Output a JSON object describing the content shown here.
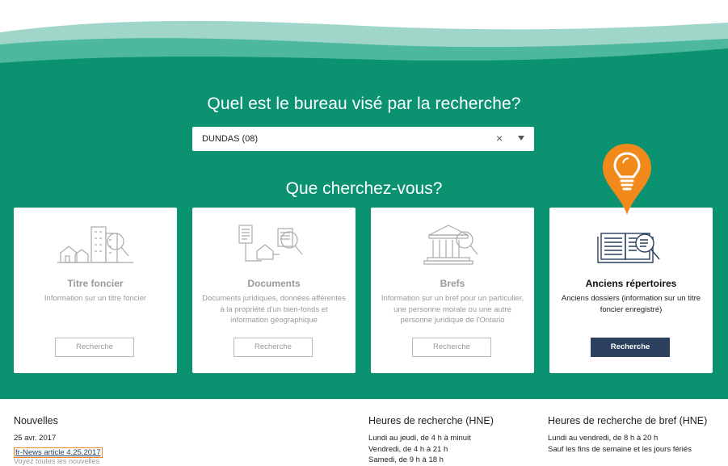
{
  "colors": {
    "hero_green": "#0b9270",
    "wave_light": "#9fd6c9",
    "wave_mid": "#4db89e",
    "primary_button": "#2b3f5f",
    "pin_orange": "#f28a1b"
  },
  "office": {
    "question": "Quel est le bureau visé par la recherche?",
    "selected_value": "DUNDAS (08)",
    "clear_glyph": "×"
  },
  "search": {
    "question": "Que cherchez-vous?",
    "cards": [
      {
        "icon": "houses-buildings-magnifier-icon",
        "title": "Titre foncier",
        "description": "Information sur un titre foncier",
        "button": "Recherche",
        "active": false
      },
      {
        "icon": "documents-house-magnifier-icon",
        "title": "Documents",
        "description": "Documents juridiques, données afférentes à la propriété d'un bien-fonds et information géographique",
        "button": "Recherche",
        "active": false
      },
      {
        "icon": "courthouse-magnifier-icon",
        "title": "Brefs",
        "description": "Information sur un bref pour un particulier, une personne morale ou une autre personne juridique de l'Ontario",
        "button": "Recherche",
        "active": false
      },
      {
        "icon": "open-book-magnifier-icon",
        "title": "Anciens répertoires",
        "description": "Anciens dossiers (information sur un titre foncier enregistré)",
        "button": "Recherche",
        "active": true
      }
    ],
    "tip_icon": "lightbulb-icon"
  },
  "footer": {
    "news": {
      "heading": "Nouvelles",
      "date": "25 avr. 2017",
      "link": "fr-News article 4.25.2017",
      "cut_text": "Voyez toutes les nouvelles"
    },
    "hours": {
      "heading": "Heures de recherche (HNE)",
      "lines": [
        "Lundi au jeudi, de 4 h à minuit",
        "Vendredi, de 4 h à 21 h",
        "Samedi, de 9 h à 18 h"
      ]
    },
    "writ_hours": {
      "heading": "Heures de recherche de bref (HNE)",
      "lines": [
        "Lundi au vendredi, de 8 h à 20 h",
        "Sauf les fins de semaine et les jours fériés"
      ]
    }
  }
}
